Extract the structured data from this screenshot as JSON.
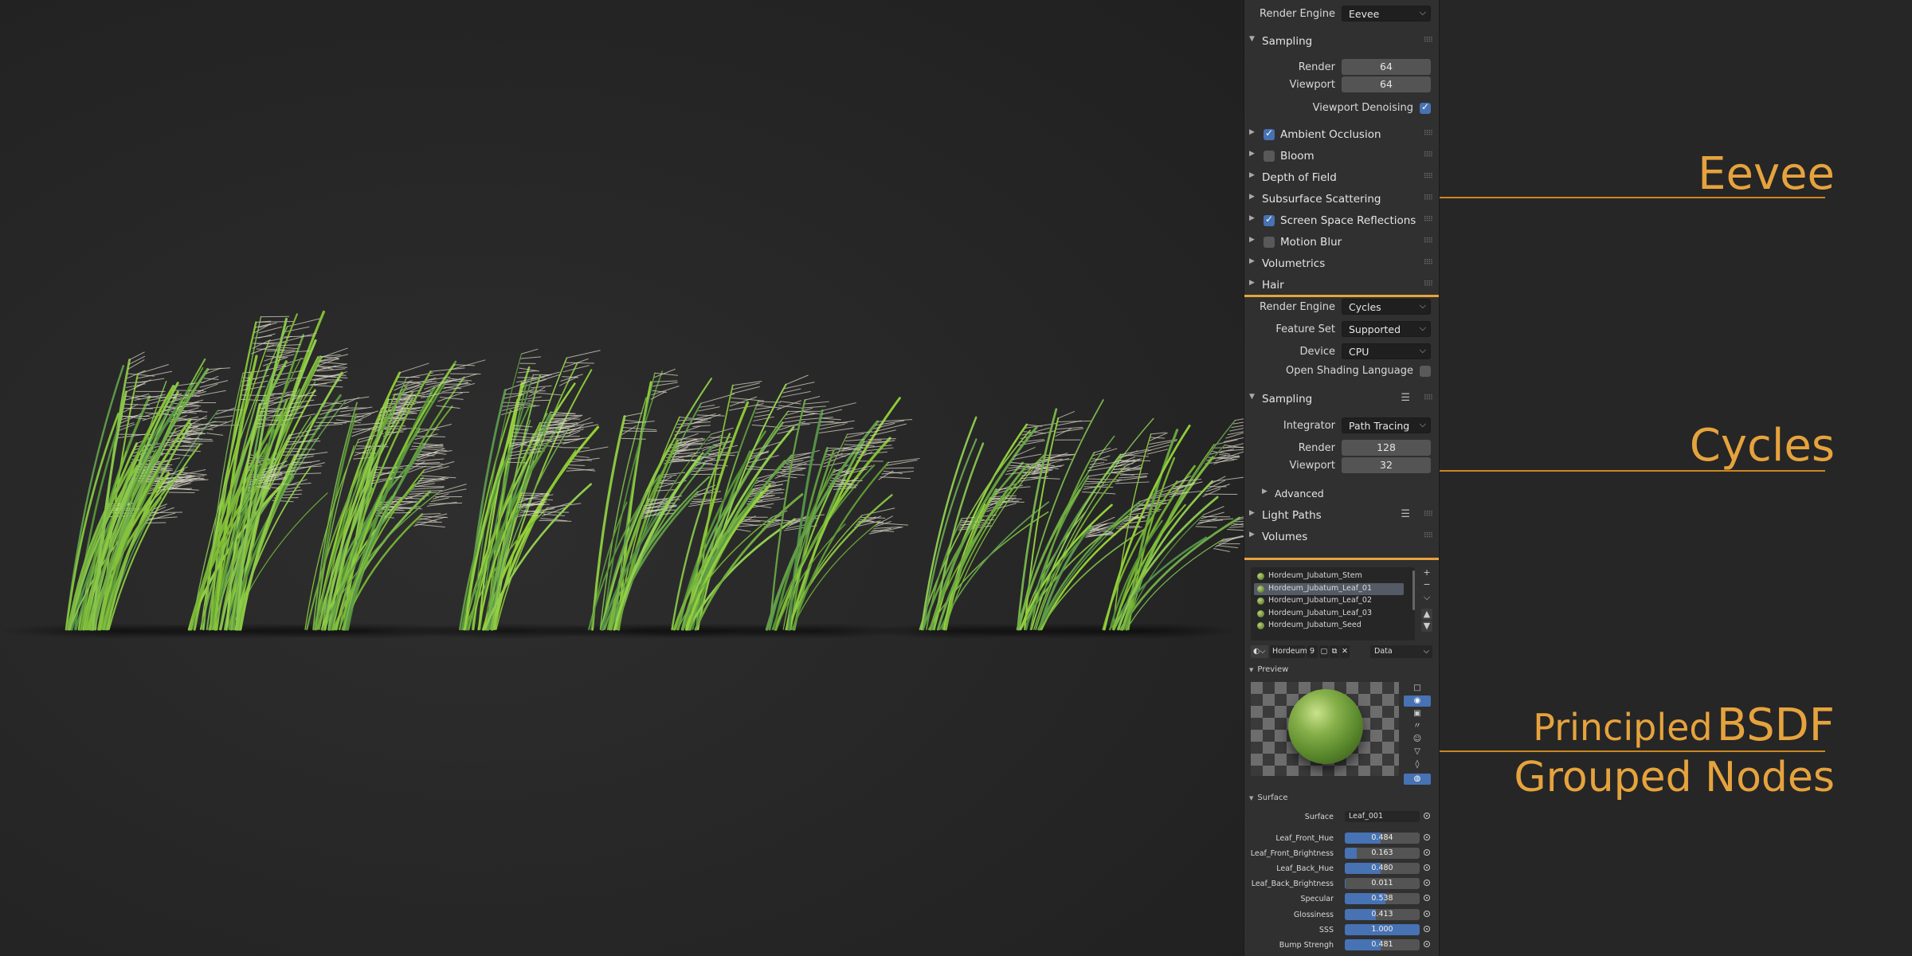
{
  "eevee": {
    "render_engine_label": "Render Engine",
    "render_engine_value": "Eevee",
    "sampling_label": "Sampling",
    "render_label": "Render",
    "render_value": "64",
    "viewport_label": "Viewport",
    "viewport_value": "64",
    "viewport_denoising_label": "Viewport Denoising",
    "viewport_denoising_checked": true,
    "panels": [
      {
        "label": "Ambient Occlusion",
        "checkbox": true,
        "checked": true
      },
      {
        "label": "Bloom",
        "checkbox": true,
        "checked": false
      },
      {
        "label": "Depth of Field",
        "checkbox": false
      },
      {
        "label": "Subsurface Scattering",
        "checkbox": false
      },
      {
        "label": "Screen Space Reflections",
        "checkbox": true,
        "checked": true
      },
      {
        "label": "Motion Blur",
        "checkbox": true,
        "checked": false
      },
      {
        "label": "Volumetrics",
        "checkbox": false
      },
      {
        "label": "Hair",
        "checkbox": false
      }
    ]
  },
  "cycles": {
    "render_engine_label": "Render Engine",
    "render_engine_value": "Cycles",
    "feature_set_label": "Feature Set",
    "feature_set_value": "Supported",
    "device_label": "Device",
    "device_value": "CPU",
    "osl_label": "Open Shading Language",
    "sampling_label": "Sampling",
    "integrator_label": "Integrator",
    "integrator_value": "Path Tracing",
    "render_label": "Render",
    "render_value": "128",
    "viewport_label": "Viewport",
    "viewport_value": "32",
    "advanced_label": "Advanced",
    "light_paths_label": "Light Paths",
    "volumes_label": "Volumes"
  },
  "material": {
    "slots": [
      "Hordeum_Jubatum_Stem",
      "Hordeum_Jubatum_Leaf_01",
      "Hordeum_Jubatum_Leaf_02",
      "Hordeum_Jubatum_Leaf_03",
      "Hordeum_Jubatum_Seed"
    ],
    "selected_index": 1,
    "name_short": "Hordeum...",
    "users": "9",
    "link_value": "Data",
    "preview_label": "Preview",
    "surface_section_label": "Surface",
    "surface_label": "Surface",
    "surface_value": "Leaf_001",
    "params": [
      {
        "label": "Leaf_Front_Hue",
        "value": "0.484",
        "fill": 0.484
      },
      {
        "label": "Leaf_Front_Brightness",
        "value": "0.163",
        "fill": 0.163
      },
      {
        "label": "Leaf_Back_Hue",
        "value": "0.480",
        "fill": 0.48
      },
      {
        "label": "Leaf_Back_Brightness",
        "value": "0.011",
        "fill": 0.011
      },
      {
        "label": "Specular",
        "value": "0.538",
        "fill": 0.538
      },
      {
        "label": "Glossiness",
        "value": "0.413",
        "fill": 0.413
      },
      {
        "label": "SSS",
        "value": "1.000",
        "fill": 1.0
      },
      {
        "label": "Bump Strengh",
        "value": "0.481",
        "fill": 0.481
      }
    ]
  },
  "annotations": {
    "eevee": "Eevee",
    "cycles": "Cycles",
    "principled_small": "Principled",
    "principled_big": "BSDF",
    "grouped_nodes": "Grouped Nodes"
  },
  "colors": {
    "accent_orange": "#e8a33a",
    "annotation_text": "#e6a33d",
    "checkbox_blue": "#4772b3",
    "panel_bg": "#303030",
    "viewport_bg": "#262626"
  },
  "icons": [
    "chevron-down-icon",
    "drag-grip-icon",
    "list-icon",
    "checkmark-icon",
    "plus-icon",
    "minus-icon",
    "sphere-icon",
    "world-icon"
  ]
}
